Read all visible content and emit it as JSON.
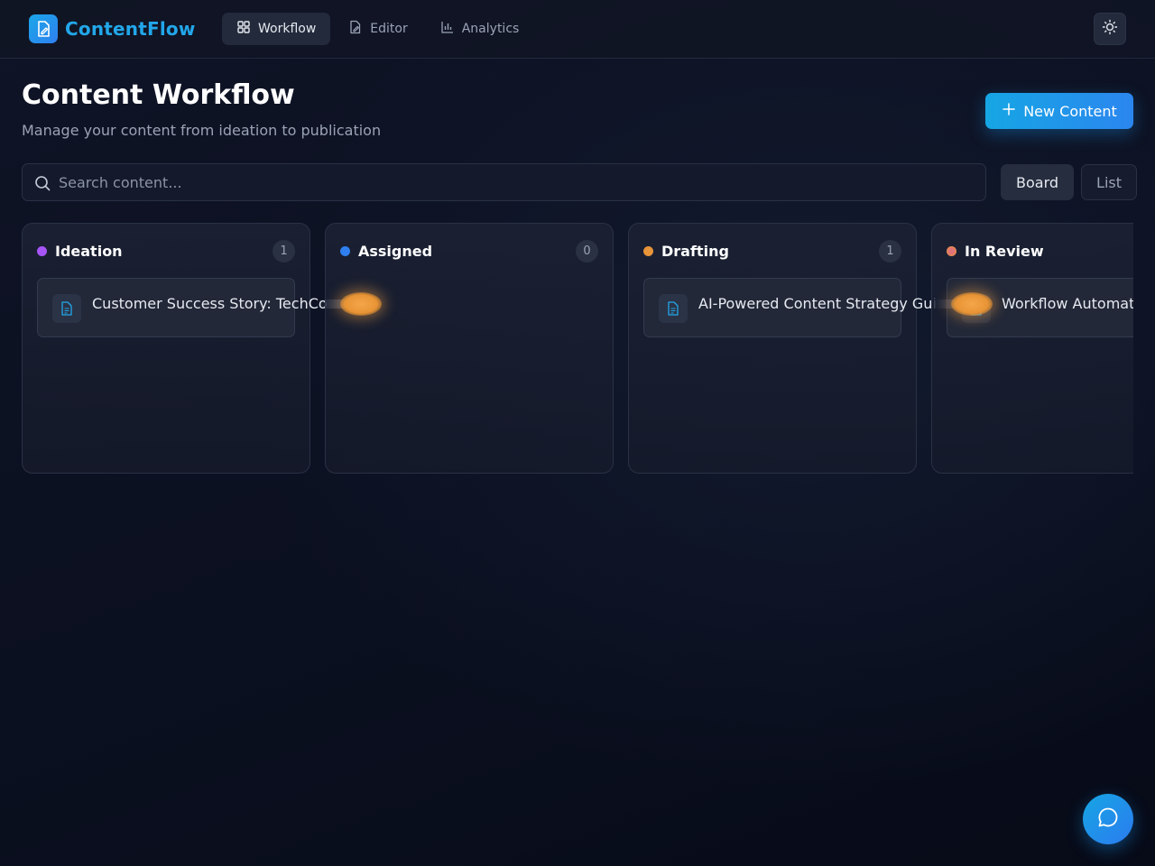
{
  "app": {
    "name": "ContentFlow",
    "accent": "#22a7ea"
  },
  "nav": {
    "items": [
      {
        "label": "Workflow",
        "icon": "grid-icon",
        "active": true
      },
      {
        "label": "Editor",
        "icon": "edit-document-icon",
        "active": false
      },
      {
        "label": "Analytics",
        "icon": "bar-chart-icon",
        "active": false
      }
    ]
  },
  "header": {
    "title": "Content Workflow",
    "subtitle": "Manage your content from ideation to publication",
    "new_button_label": "New Content"
  },
  "search": {
    "placeholder": "Search content...",
    "value": ""
  },
  "view_toggle": {
    "board_label": "Board",
    "list_label": "List",
    "active": "Board"
  },
  "columns": [
    {
      "title": "Ideation",
      "count": "1",
      "color": "#a855f7",
      "cards": [
        {
          "title": "Customer Success Story: TechCo"
        }
      ]
    },
    {
      "title": "Assigned",
      "count": "0",
      "color": "#2f7ff0",
      "cards": []
    },
    {
      "title": "Drafting",
      "count": "1",
      "color": "#e8943a",
      "cards": [
        {
          "title": "AI-Powered Content Strategy Gui"
        }
      ]
    },
    {
      "title": "In Review",
      "count": "",
      "color": "#e0727a",
      "cards": [
        {
          "title": "Workflow Automat"
        }
      ]
    }
  ],
  "icons": {
    "theme_toggle": "sun-icon",
    "chat_fab": "chat-bubble-icon",
    "card": "document-icon",
    "add": "plus-icon",
    "search": "search-icon"
  }
}
